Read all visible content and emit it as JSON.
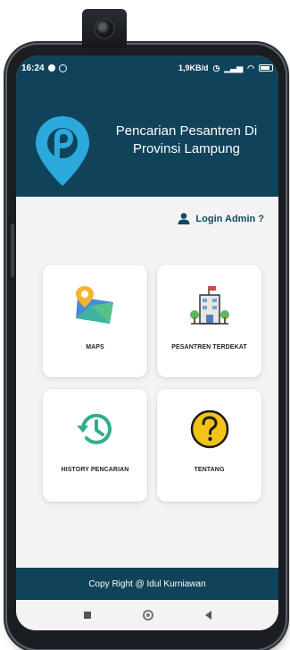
{
  "status_bar": {
    "time": "16:24",
    "network_speed": "1,9KB/d",
    "battery_level": "42"
  },
  "header": {
    "title": "Pencarian Pesantren Di Provinsi Lampung",
    "brand_color": "#10425a",
    "logo_icon": "location-pin-logo-icon"
  },
  "login": {
    "label": "Login Admin ?",
    "icon": "user-icon"
  },
  "menu": [
    {
      "label": "MAPS",
      "icon": "map-icon"
    },
    {
      "label": "PESANTREN TERDEKAT",
      "icon": "building-icon"
    },
    {
      "label": "HISTORY PENCARIAN",
      "icon": "history-icon"
    },
    {
      "label": "TENTANG",
      "icon": "question-icon"
    }
  ],
  "footer": {
    "text": "Copy Right @ Idul Kurniawan"
  },
  "nav_bar": {
    "buttons": [
      "recent-apps",
      "home",
      "back"
    ]
  }
}
